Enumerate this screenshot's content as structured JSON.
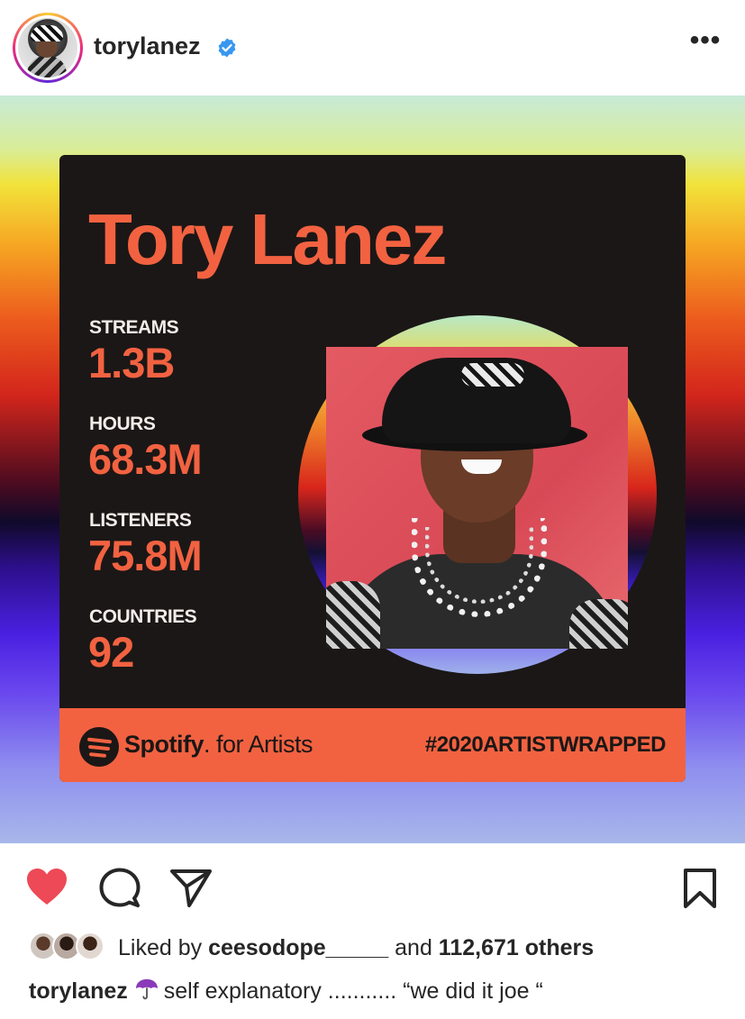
{
  "header": {
    "username": "torylanez",
    "verified": true,
    "more_icon": "more-horizontal-icon",
    "more_label": "•••"
  },
  "post": {
    "card": {
      "artist_name": "Tory Lanez",
      "stats": [
        {
          "label": "STREAMS",
          "value": "1.3B"
        },
        {
          "label": "HOURS",
          "value": "68.3M"
        },
        {
          "label": "LISTENERS",
          "value": "75.8M"
        },
        {
          "label": "COUNTRIES",
          "value": "92"
        }
      ],
      "footer": {
        "brand": "Spotify",
        "brand_suffix": ". for Artists",
        "hashtag": "#2020ARTISTWRAPPED"
      },
      "colors": {
        "accent": "#f26241",
        "card_bg": "#1b1716"
      }
    }
  },
  "actions": {
    "like_icon": "heart-filled-icon",
    "comment_icon": "comment-icon",
    "share_icon": "send-icon",
    "save_icon": "bookmark-icon",
    "like_color": "#ed4956"
  },
  "likes": {
    "prefix": "Liked by ",
    "user": "ceesodope_____",
    "middle": " and ",
    "count": "112,671 others"
  },
  "caption": {
    "user": "torylanez",
    "emoji_icon": "umbrella-icon",
    "text": "self explanatory ........... “we did it joe “"
  }
}
